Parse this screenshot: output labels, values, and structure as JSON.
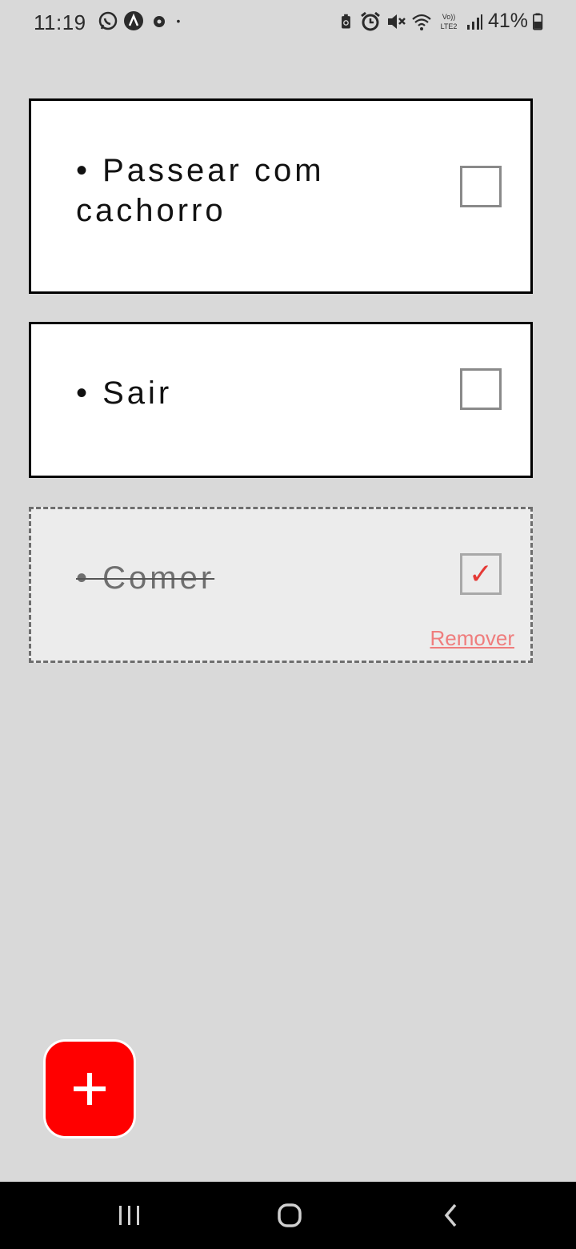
{
  "status_bar": {
    "time": "11:19",
    "battery_percent": "41%",
    "left_icons": [
      "whatsapp-icon",
      "app-a-icon",
      "app-circle-icon",
      "dot-icon"
    ],
    "right_icons": [
      "battery-saver-icon",
      "alarm-icon",
      "mute-icon",
      "wifi-icon",
      "volte-lte2-icon",
      "signal-icon",
      "battery-icon"
    ]
  },
  "tasks": [
    {
      "label": "• Passear com cachorro",
      "checked": false
    },
    {
      "label": "• Sair",
      "checked": false
    },
    {
      "label": "• Comer",
      "checked": true,
      "remove_label": "Remover"
    }
  ],
  "fab": {
    "icon": "plus-icon",
    "color": "#ff0000"
  },
  "nav_bar": {
    "items": [
      "recents-icon",
      "home-icon",
      "back-icon"
    ]
  }
}
